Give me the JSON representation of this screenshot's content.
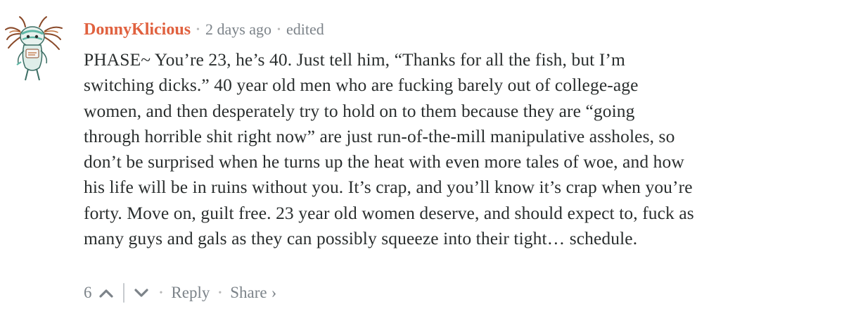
{
  "comment": {
    "author": "DonnyKlicious",
    "time": "2 days ago",
    "status": "edited",
    "separator": "•",
    "body": "PHASE~ You’re 23, he’s 40. Just tell him, “Thanks for all the fish, but I’m\nswitching dicks.” 40 year old men who are fucking barely out of college-age\nwomen, and then desperately try to hold on to them because they are “going\nthrough horrible shit right now” are just run-of-the-mill manipulative assholes, so\ndon’t be surprised when he turns up the heat with even more tales of woe, and how\nhis life will be in ruins without you. It’s crap, and you’ll know it’s crap when you’re\nforty. Move on, guilt free. 23 year old women deserve, and should expect to, fuck as\nmany guys and gals as they can possibly squeeze into their tight… schedule.",
    "votes": "6",
    "reply_label": "Reply",
    "share_label": "Share",
    "share_chevron": "›"
  },
  "icons": {
    "avatar": "crazy-character-avatar",
    "upvote": "chevron-up-icon",
    "downvote": "chevron-down-icon"
  },
  "colors": {
    "author": "#e0613f",
    "meta": "#7c8389",
    "body_text": "#2a2e2e",
    "separator": "#c7cbcf",
    "avatar_accent": "#5fb8a6"
  }
}
